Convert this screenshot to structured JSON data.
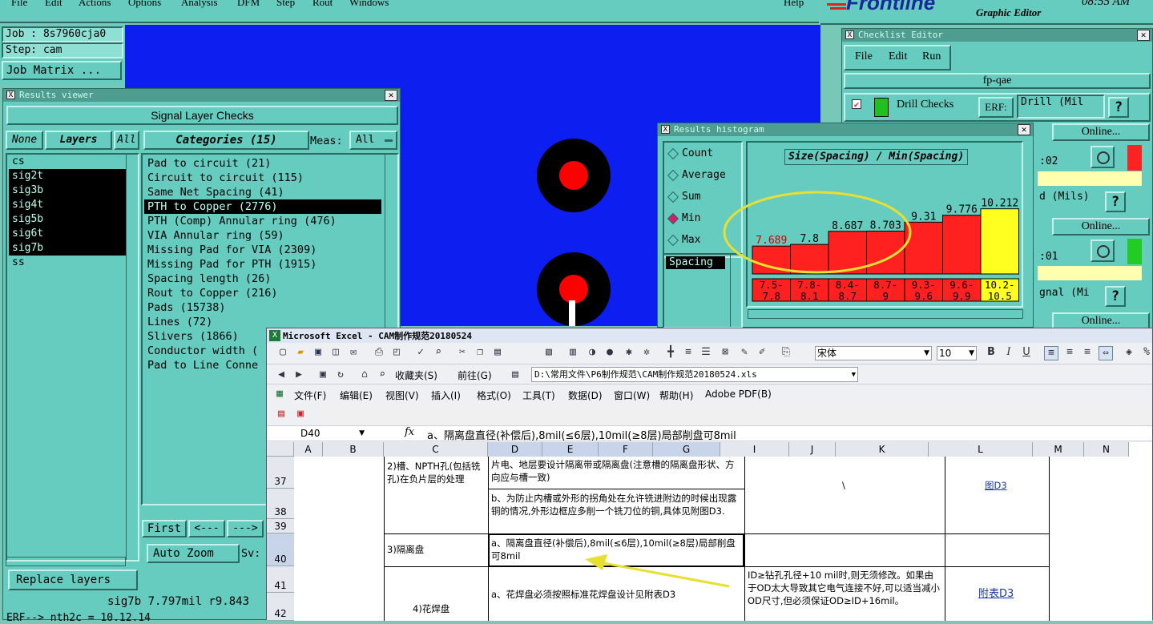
{
  "topmenu": [
    "File",
    "Edit",
    "Actions",
    "Options",
    "Analysis",
    "DFM",
    "Step",
    "Rout",
    "Windows"
  ],
  "help_label": "Help",
  "brand": "Frontline",
  "brand_sub": "Graphic Editor",
  "clock": "08:55 AM",
  "job_label": "Job : 8s7960cja0",
  "step_label": "Step: cam",
  "job_matrix": "Job Matrix ...",
  "results_viewer": {
    "title": "Results viewer",
    "header": "Signal Layer Checks",
    "none_btn": "None",
    "layers_btn": "Layers",
    "all_btn": "All",
    "categories_btn": "Categories (15)",
    "meas_label": "Meas:",
    "meas_value": "All",
    "layers": [
      {
        "name": "cs",
        "sel": false
      },
      {
        "name": "sig2t",
        "sel": true
      },
      {
        "name": "sig3b",
        "sel": true
      },
      {
        "name": "sig4t",
        "sel": true
      },
      {
        "name": "sig5b",
        "sel": true
      },
      {
        "name": "sig6t",
        "sel": true
      },
      {
        "name": "sig7b",
        "sel": true
      },
      {
        "name": "ss",
        "sel": false
      }
    ],
    "categories": [
      {
        "name": "Pad to circuit (21)",
        "sel": false
      },
      {
        "name": "Circuit to circuit (115)",
        "sel": false
      },
      {
        "name": "Same Net Spacing (41)",
        "sel": false
      },
      {
        "name": "PTH to Copper (2776)",
        "sel": true
      },
      {
        "name": "PTH (Comp) Annular ring (476)",
        "sel": false
      },
      {
        "name": "VIA Annular ring (59)",
        "sel": false
      },
      {
        "name": "Missing Pad for VIA (2309)",
        "sel": false
      },
      {
        "name": "Missing Pad for PTH (1915)",
        "sel": false
      },
      {
        "name": "Spacing length (26)",
        "sel": false
      },
      {
        "name": "Rout to Copper (216)",
        "sel": false
      },
      {
        "name": "Pads (15738)",
        "sel": false
      },
      {
        "name": "Lines (72)",
        "sel": false
      },
      {
        "name": "Slivers (1866)",
        "sel": false
      },
      {
        "name": "Conductor width (",
        "sel": false
      },
      {
        "name": "Pad to Line Conne",
        "sel": false
      }
    ],
    "first_btn": "First",
    "prev_btn": "<---",
    "next_btn": "--->",
    "auto_zoom": "Auto Zoom",
    "sv_label": "Sv:",
    "replace_layers": "Replace layers",
    "status": "sig7b 7.797mil  r9.843",
    "status2": "ERF--> nth2c = 10.12.14"
  },
  "checklist": {
    "title": "Checklist Editor",
    "menu": [
      "File",
      "Edit",
      "Run"
    ],
    "name": "fp-qae",
    "drill_checks": "Drill Checks",
    "erf_label": "ERF:",
    "erf_value": "Drill (Mil",
    "q": "?",
    "online": "Online...",
    "row2_text": ":02",
    "row3_text": "d (Mils)",
    "row4_text": ":01",
    "row5_text": "gnal (Mi"
  },
  "histogram": {
    "title": "Results histogram",
    "options": [
      {
        "label": "Count",
        "on": false
      },
      {
        "label": "Average",
        "on": false
      },
      {
        "label": "Sum",
        "on": false
      },
      {
        "label": "Min",
        "on": true
      },
      {
        "label": "Max",
        "on": false
      }
    ],
    "spacing_item": "Spacing",
    "chart_title": "Size(Spacing) / Min(Spacing)"
  },
  "chart_data": {
    "type": "bar",
    "title": "Size(Spacing) / Min(Spacing)",
    "categories": [
      "7.5-7.8",
      "7.8-8.1",
      "8.4-8.7",
      "8.7-9",
      "9.3-9.6",
      "9.6-9.9",
      "10.2-10.5"
    ],
    "category_lines": [
      [
        "7.5-",
        "7.8"
      ],
      [
        "7.8-",
        "8.1"
      ],
      [
        "8.4-",
        "8.7"
      ],
      [
        "8.7-",
        "9"
      ],
      [
        "9.3-",
        "9.6"
      ],
      [
        "9.6-",
        "9.9"
      ],
      [
        "10.2-",
        "10.5"
      ]
    ],
    "values": [
      7.689,
      7.8,
      8.687,
      8.703,
      9.31,
      9.776,
      10.212
    ],
    "value_labels": [
      "7.689",
      "7.8",
      "8.687",
      "8.703",
      "9.31",
      "9.776",
      "10.212"
    ],
    "bar_colors": [
      "#ff2020",
      "#ff2020",
      "#ff2020",
      "#ff2020",
      "#ff2020",
      "#ff2020",
      "#ffff20"
    ],
    "ylim": [
      5.8,
      10.9
    ]
  },
  "excel": {
    "title": "Microsoft Excel - CAM制作规范20180524",
    "font_name": "宋体",
    "font_size": "10",
    "favorites": "收藏夹(S)",
    "goto": "前往(G)",
    "path": "D:\\常用文件\\P6制作规范\\CAM制作规范20180524.xls",
    "menu": [
      "文件(F)",
      "编辑(E)",
      "视图(V)",
      "插入(I)",
      "格式(O)",
      "工具(T)",
      "数据(D)",
      "窗口(W)",
      "帮助(H)",
      "Adobe PDF(B)"
    ],
    "cell_ref": "D40",
    "fx": "fx",
    "formula": "a、隔离盘直径(补偿后),8mil(≤6层),10mil(≥8层)局部削盘可8mil",
    "columns": [
      "A",
      "B",
      "C",
      "D",
      "E",
      "F",
      "G",
      "I",
      "J",
      "K",
      "L",
      "M",
      "N"
    ],
    "rows": [
      "37",
      "38",
      "39",
      "40",
      "41",
      "42"
    ],
    "c37": "2)槽、NPTH孔(包括铣孔)在负片层的处理",
    "d37": "片电、地层要设计隔离带或隔离盘(注意槽的隔离盘形状、方向应与槽一致)",
    "d38": "b、为防止内槽或外形的拐角处在允许铣进附边的时候出现露铜的情况,外形边框应多削一个铣刀位的铜,具体见附图D3.",
    "slash": "\\",
    "l37": "图D3",
    "c40": "3)隔离盘",
    "d40": "a、隔离盘直径(补偿后),8mil(≤6层),10mil(≥8层)局部削盘可8mil",
    "c41": "4)花焊盘",
    "d41": "a、花焊盘必须按照标准花焊盘设计见附表D3",
    "i41": "ID≥钻孔孔径+10 mil时,则无须修改。如果由于OD太大导致其它电气连接不好,可以适当减小OD尺寸,但必须保证OD≥ID+16mil。",
    "l41": "附表D3"
  }
}
